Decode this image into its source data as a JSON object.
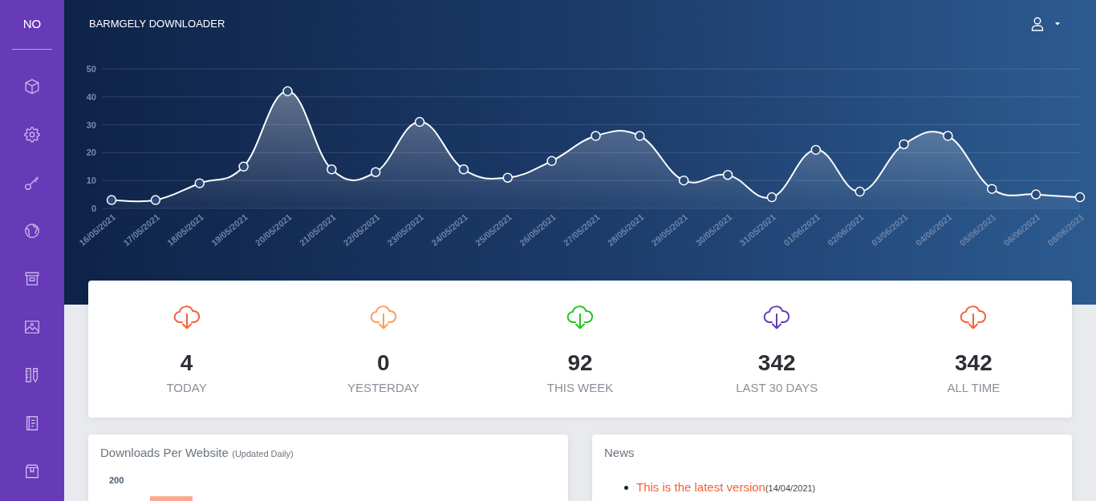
{
  "sidebar": {
    "logo": "NO"
  },
  "header": {
    "title": "BARMGELY DOWNLOADER"
  },
  "downloads_chart": {
    "chart_data": {
      "type": "area",
      "grid": true,
      "categories": [
        "16/05/2021",
        "17/05/2021",
        "18/05/2021",
        "19/05/2021",
        "20/05/2021",
        "21/05/2021",
        "22/05/2021",
        "23/05/2021",
        "24/05/2021",
        "25/05/2021",
        "26/05/2021",
        "27/05/2021",
        "28/05/2021",
        "29/05/2021",
        "30/05/2021",
        "31/05/2021",
        "01/06/2021",
        "02/06/2021",
        "03/06/2021",
        "04/06/2021",
        "05/06/2021",
        "06/06/2021",
        "08/06/2021"
      ],
      "series": [
        {
          "color": "#ffffff",
          "values": [
            3,
            3,
            9,
            15,
            42,
            14,
            13,
            31,
            14,
            11,
            17,
            26,
            26,
            10,
            12,
            4,
            21,
            6,
            23,
            26,
            7,
            5,
            4
          ]
        }
      ],
      "ylim": [
        0,
        50
      ],
      "yticks": [
        0,
        10,
        20,
        30,
        40,
        50
      ]
    }
  },
  "stats": [
    {
      "value": "4",
      "label": "TODAY",
      "color": "#f4603a"
    },
    {
      "value": "0",
      "label": "YESTERDAY",
      "color": "#ff9a5c"
    },
    {
      "value": "92",
      "label": "THIS WEEK",
      "color": "#22c41e"
    },
    {
      "value": "342",
      "label": "LAST 30 DAYS",
      "color": "#673ab7"
    },
    {
      "value": "342",
      "label": "ALL TIME",
      "color": "#f4603a"
    }
  ],
  "website_panel": {
    "title": "Downloads Per Website",
    "subtitle": "(Updated Daily)",
    "y_tick_label": "200"
  },
  "news_panel": {
    "title": "News",
    "items": [
      {
        "link": "This is the latest version",
        "date": "(14/04/2021)"
      }
    ]
  }
}
